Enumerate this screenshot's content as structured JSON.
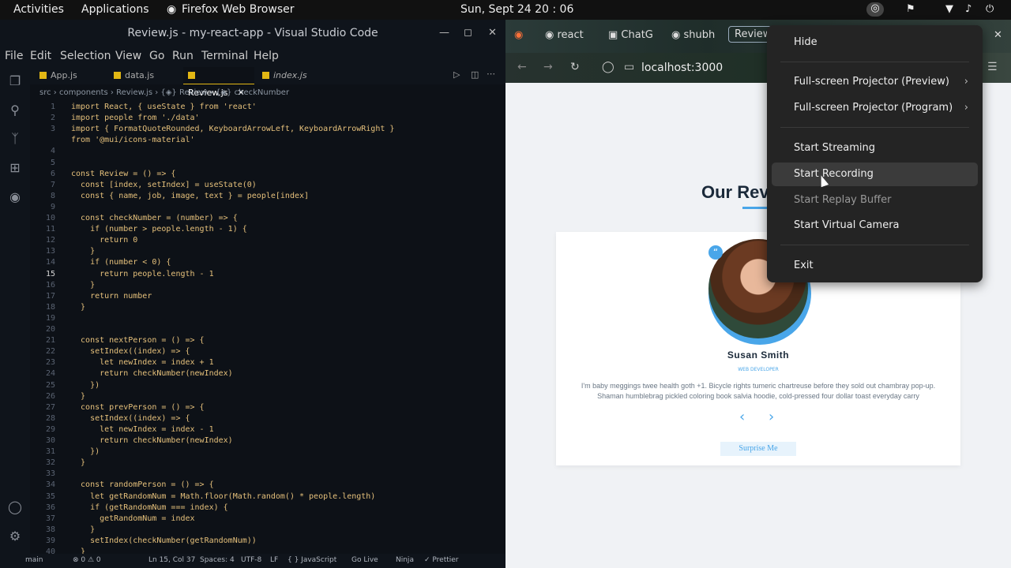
{
  "topbar": {
    "activities": "Activities",
    "applications": "Applications",
    "app_name": "Firefox Web Browser",
    "datetime": "Sun, Sept 24  20 : 06"
  },
  "vscode": {
    "title": "Review.js - my-react-app - Visual Studio Code",
    "menu": [
      "File",
      "Edit",
      "Selection",
      "View",
      "Go",
      "Run",
      "Terminal",
      "Help"
    ],
    "tabs": [
      "App.js",
      "data.js",
      "Review.js",
      "index.js"
    ],
    "breadcrumb": "src  › components  ›  Review.js  ›  {◈} Review  ›  {◈} checkNumber",
    "lines": [
      {
        "n": "1",
        "t": "import React, { useState } from 'react'"
      },
      {
        "n": "2",
        "t": "import people from './data'"
      },
      {
        "n": "3",
        "t": "import { FormatQuoteRounded, KeyboardArrowLeft, KeyboardArrowRight }"
      },
      {
        "n": "",
        "t": "from '@mui/icons-material'"
      },
      {
        "n": "4",
        "t": ""
      },
      {
        "n": "5",
        "t": ""
      },
      {
        "n": "6",
        "t": "const Review = () => {"
      },
      {
        "n": "7",
        "t": "  const [index, setIndex] = useState(0)"
      },
      {
        "n": "8",
        "t": "  const { name, job, image, text } = people[index]"
      },
      {
        "n": "9",
        "t": ""
      },
      {
        "n": "10",
        "t": "  const checkNumber = (number) => {"
      },
      {
        "n": "11",
        "t": "    if (number > people.length - 1) {"
      },
      {
        "n": "12",
        "t": "      return 0"
      },
      {
        "n": "13",
        "t": "    }"
      },
      {
        "n": "14",
        "t": "    if (number < 0) {"
      },
      {
        "n": "15",
        "t": "      return people.length - 1"
      },
      {
        "n": "16",
        "t": "    }"
      },
      {
        "n": "17",
        "t": "    return number"
      },
      {
        "n": "18",
        "t": "  }"
      },
      {
        "n": "19",
        "t": ""
      },
      {
        "n": "20",
        "t": ""
      },
      {
        "n": "21",
        "t": "  const nextPerson = () => {"
      },
      {
        "n": "22",
        "t": "    setIndex((index) => {"
      },
      {
        "n": "23",
        "t": "      let newIndex = index + 1"
      },
      {
        "n": "24",
        "t": "      return checkNumber(newIndex)"
      },
      {
        "n": "25",
        "t": "    })"
      },
      {
        "n": "26",
        "t": "  }"
      },
      {
        "n": "27",
        "t": "  const prevPerson = () => {"
      },
      {
        "n": "28",
        "t": "    setIndex((index) => {"
      },
      {
        "n": "29",
        "t": "      let newIndex = index - 1"
      },
      {
        "n": "30",
        "t": "      return checkNumber(newIndex)"
      },
      {
        "n": "31",
        "t": "    })"
      },
      {
        "n": "32",
        "t": "  }"
      },
      {
        "n": "33",
        "t": ""
      },
      {
        "n": "34",
        "t": "  const randomPerson = () => {"
      },
      {
        "n": "35",
        "t": "    let getRandomNum = Math.floor(Math.random() * people.length)"
      },
      {
        "n": "36",
        "t": "    if (getRandomNum === index) {"
      },
      {
        "n": "37",
        "t": "      getRandomNum = index"
      },
      {
        "n": "38",
        "t": "    }"
      },
      {
        "n": "39",
        "t": "    setIndex(checkNumber(getRandomNum))"
      },
      {
        "n": "40",
        "t": "  }"
      }
    ],
    "status": {
      "branch": "main",
      "problems": "⊗ 0 ⚠ 0",
      "position": "Ln 15, Col 37",
      "spaces": "Spaces: 4",
      "encoding": "UTF-8",
      "eol": "LF",
      "language": "{ } JavaScript",
      "golive": "Go Live",
      "ninja": "Ninja",
      "prettier": "✓ Prettier"
    }
  },
  "firefox": {
    "tabs": [
      "react",
      "ChatG",
      "shubh",
      "Review"
    ],
    "url": "localhost:3000",
    "page": {
      "title": "Our Reviews",
      "name": "Susan Smith",
      "job": "Web Developer",
      "text": "I'm baby meggings twee health goth +1. Bicycle rights tumeric chartreuse before they sold out chambray pop-up. Shaman humblebrag pickled coloring book salvia hoodie, cold-pressed four dollar toast everyday carry",
      "surprise": "Surprise Me"
    }
  },
  "context_menu": {
    "items": [
      "Hide",
      "Full-screen Projector (Preview)",
      "Full-screen Projector (Program)",
      "Start Streaming",
      "Start Recording",
      "Start Replay Buffer",
      "Start Virtual Camera",
      "Exit"
    ]
  }
}
